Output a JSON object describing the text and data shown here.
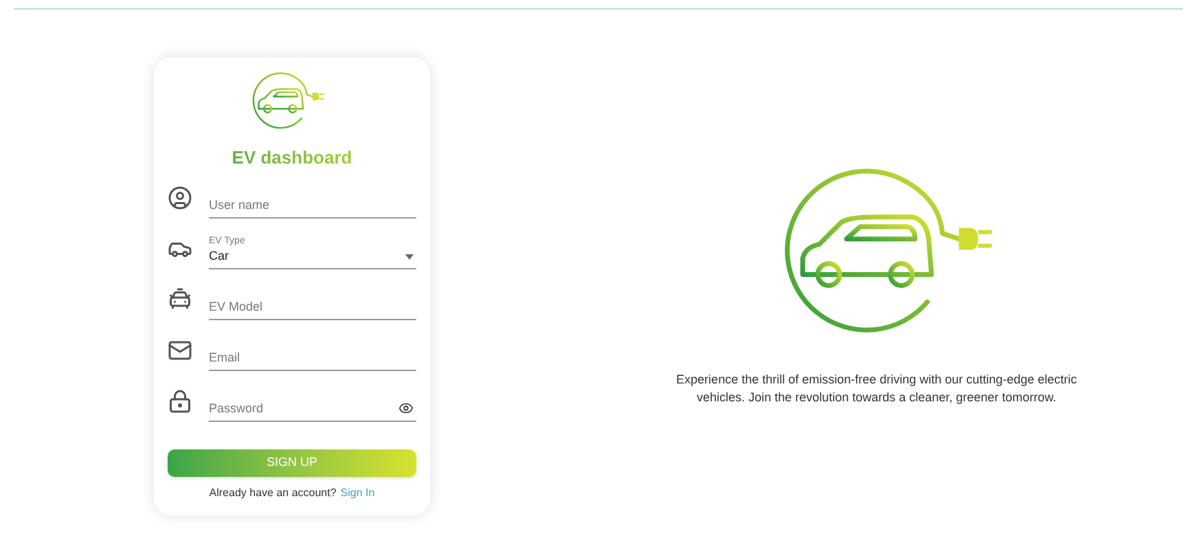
{
  "card": {
    "title": "EV dashboard",
    "fields": [
      {
        "kind": "input",
        "placeholder": "User name"
      },
      {
        "kind": "select",
        "label": "EV Type",
        "value": "Car"
      },
      {
        "kind": "input",
        "placeholder": "EV Model"
      },
      {
        "kind": "input",
        "placeholder": "Email"
      },
      {
        "kind": "password",
        "placeholder": "Password"
      }
    ],
    "button": "SIGN UP",
    "footer": "Already have an account?",
    "link": "Sign In"
  },
  "hero": {
    "text": "Experience the thrill of emission-free driving with our cutting-edge electric vehicles. Join the revolution towards a cleaner, greener tomorrow."
  }
}
